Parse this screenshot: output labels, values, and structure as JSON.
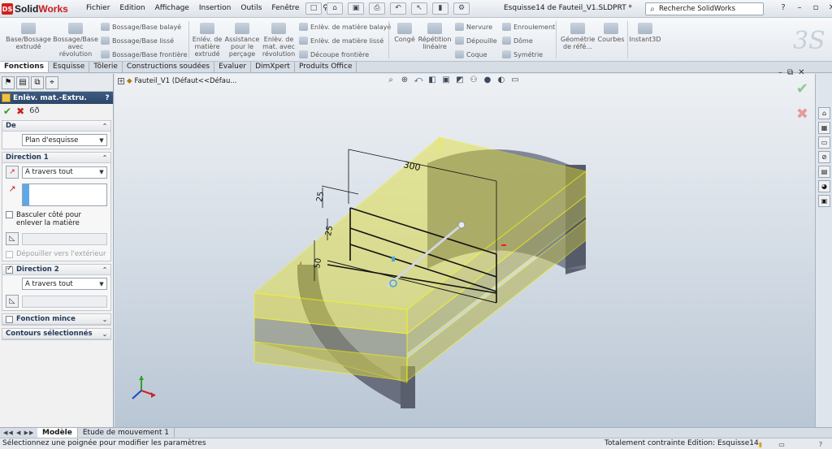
{
  "app": {
    "name_left": "Solid",
    "name_right": "Works",
    "logo_letters": "DS"
  },
  "menu": [
    "Fichier",
    "Edition",
    "Affichage",
    "Insertion",
    "Outils",
    "Fenêtre",
    "?"
  ],
  "document_title": "Esquisse14 de Fauteil_V1.SLDPRT *",
  "search": {
    "placeholder": "Recherche SolidWorks"
  },
  "ribbon": {
    "base_extrude": "Base/Bossage extrudé",
    "base_revolve": "Bossage/Base avec révolution",
    "swept": "Bossage/Base balayé",
    "loft": "Bossage/Base lissé",
    "boundary": "Bossage/Base frontière",
    "cut_extrude": "Enlév. de matière extrudé",
    "hole_wizard": "Assistance pour le perçage",
    "cut_revolve": "Enlèv. de mat. avec révolution",
    "cut_swept": "Enlèv. de matière balayé",
    "cut_loft": "Enlèv. de matière lissé",
    "cut_boundary": "Découpe frontière",
    "fillet": "Congé",
    "pattern": "Répétition linéaire",
    "rib": "Nervure",
    "draft": "Dépouille",
    "shell": "Coque",
    "wrap": "Enroulement",
    "dome": "Dôme",
    "mirror": "Symétrie",
    "ref_geometry": "Géométrie de réfé...",
    "curves": "Courbes",
    "instant3d": "Instant3D"
  },
  "tabs": [
    "Fonctions",
    "Esquisse",
    "Tôlerie",
    "Constructions soudées",
    "Evaluer",
    "DimXpert",
    "Produits Office"
  ],
  "property_manager": {
    "title": "Enlèv. mat.-Extru.",
    "help": "?",
    "from": {
      "header": "De",
      "value": "Plan d'esquisse"
    },
    "direction1": {
      "header": "Direction 1",
      "end_condition": "A travers tout",
      "flip_label": "Basculer côté pour enlever la matière",
      "draft_label": "Dépouiller vers l'extérieur"
    },
    "direction2": {
      "header": "Direction 2",
      "end_condition": "A travers tout"
    },
    "thin": {
      "header": "Fonction mince"
    },
    "contours": {
      "header": "Contours sélectionnés"
    }
  },
  "tree": {
    "label": "Fauteil_V1  (Défaut<<Défau..."
  },
  "dimensions": {
    "d300": "300",
    "d25a": "25",
    "d25b": "25",
    "d50": "50"
  },
  "bottom_tabs": [
    "Modèle",
    "Etude de mouvement 1"
  ],
  "status": {
    "message": "Sélectionnez une poignée pour modifier les paramètres",
    "constraint": "Totalement contrainte",
    "editing": "Edition: Esquisse14"
  },
  "colors": {
    "accent": "#2c4668",
    "selection": "#f2f215",
    "model": "#5c6170"
  }
}
